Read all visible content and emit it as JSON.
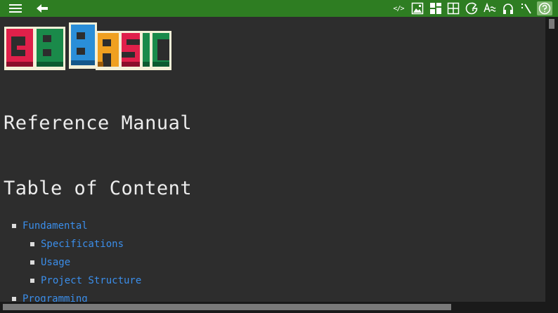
{
  "toolbar": {
    "left": [
      {
        "name": "menu",
        "icon": "hamburger-icon"
      },
      {
        "name": "back",
        "icon": "arrow-left-icon"
      }
    ],
    "right": [
      {
        "name": "code",
        "icon": "code-icon",
        "label": "</>"
      },
      {
        "name": "image",
        "icon": "image-icon"
      },
      {
        "name": "tiles",
        "icon": "tiles-icon"
      },
      {
        "name": "map",
        "icon": "map-grid-icon"
      },
      {
        "name": "palette",
        "icon": "palette-icon"
      },
      {
        "name": "font",
        "icon": "font-icon"
      },
      {
        "name": "audio",
        "icon": "headphones-icon"
      },
      {
        "name": "console",
        "icon": "console-icon"
      },
      {
        "name": "help",
        "icon": "help-icon",
        "active": true
      }
    ]
  },
  "logo": {
    "text": "GB BASIC"
  },
  "page": {
    "heading": "Reference Manual",
    "toc_heading": "Table of Content",
    "toc": [
      {
        "label": "Fundamental",
        "level": 1
      },
      {
        "label": "Specifications",
        "level": 2
      },
      {
        "label": "Usage",
        "level": 2
      },
      {
        "label": "Project Structure",
        "level": 2
      },
      {
        "label": "Programming",
        "level": 1
      }
    ]
  },
  "colors": {
    "toolbar": "#2e7d22",
    "background": "#2d2d2d",
    "link": "#3b8eea",
    "text": "#ececec"
  }
}
